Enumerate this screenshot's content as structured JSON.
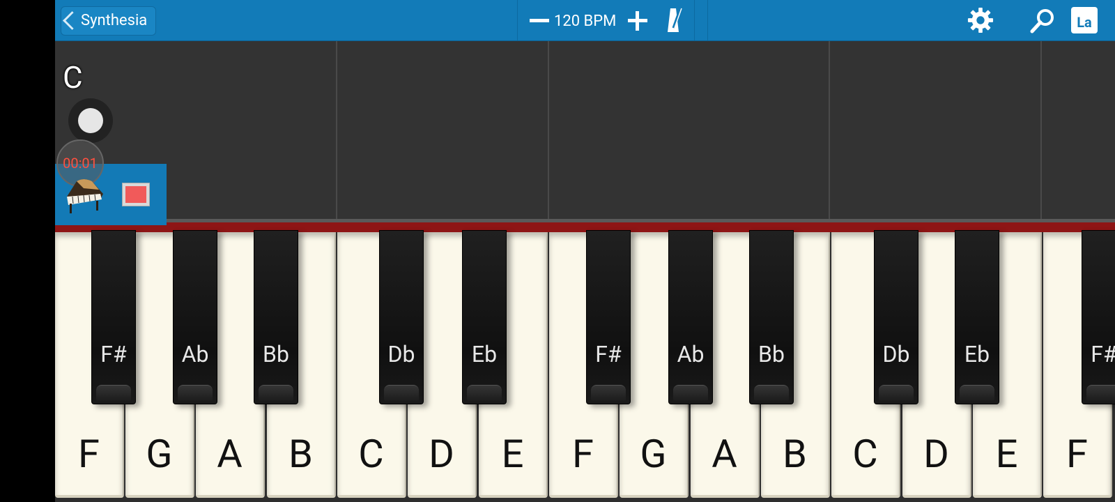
{
  "topbar": {
    "back_label": "Synthesia",
    "bpm_label": "120 BPM",
    "la_label": "La",
    "accent_color": "#127bb8"
  },
  "roll": {
    "current_key": "C",
    "timer": "00:01"
  },
  "keyboard": {
    "white_keys": [
      "F",
      "G",
      "A",
      "B",
      "C",
      "D",
      "E",
      "F",
      "G",
      "A",
      "B",
      "C",
      "D",
      "E",
      "F"
    ],
    "black_keys": [
      "F#",
      "Ab",
      "Bb",
      "Db",
      "Eb",
      "F#",
      "Ab",
      "Bb",
      "Db",
      "Eb",
      "F#"
    ]
  },
  "icons": [
    "back-chevron-icon",
    "minus-icon",
    "plus-icon",
    "metronome-icon",
    "gear-icon",
    "magnifier-icon",
    "record-icon",
    "piano-icon",
    "stop-icon"
  ]
}
